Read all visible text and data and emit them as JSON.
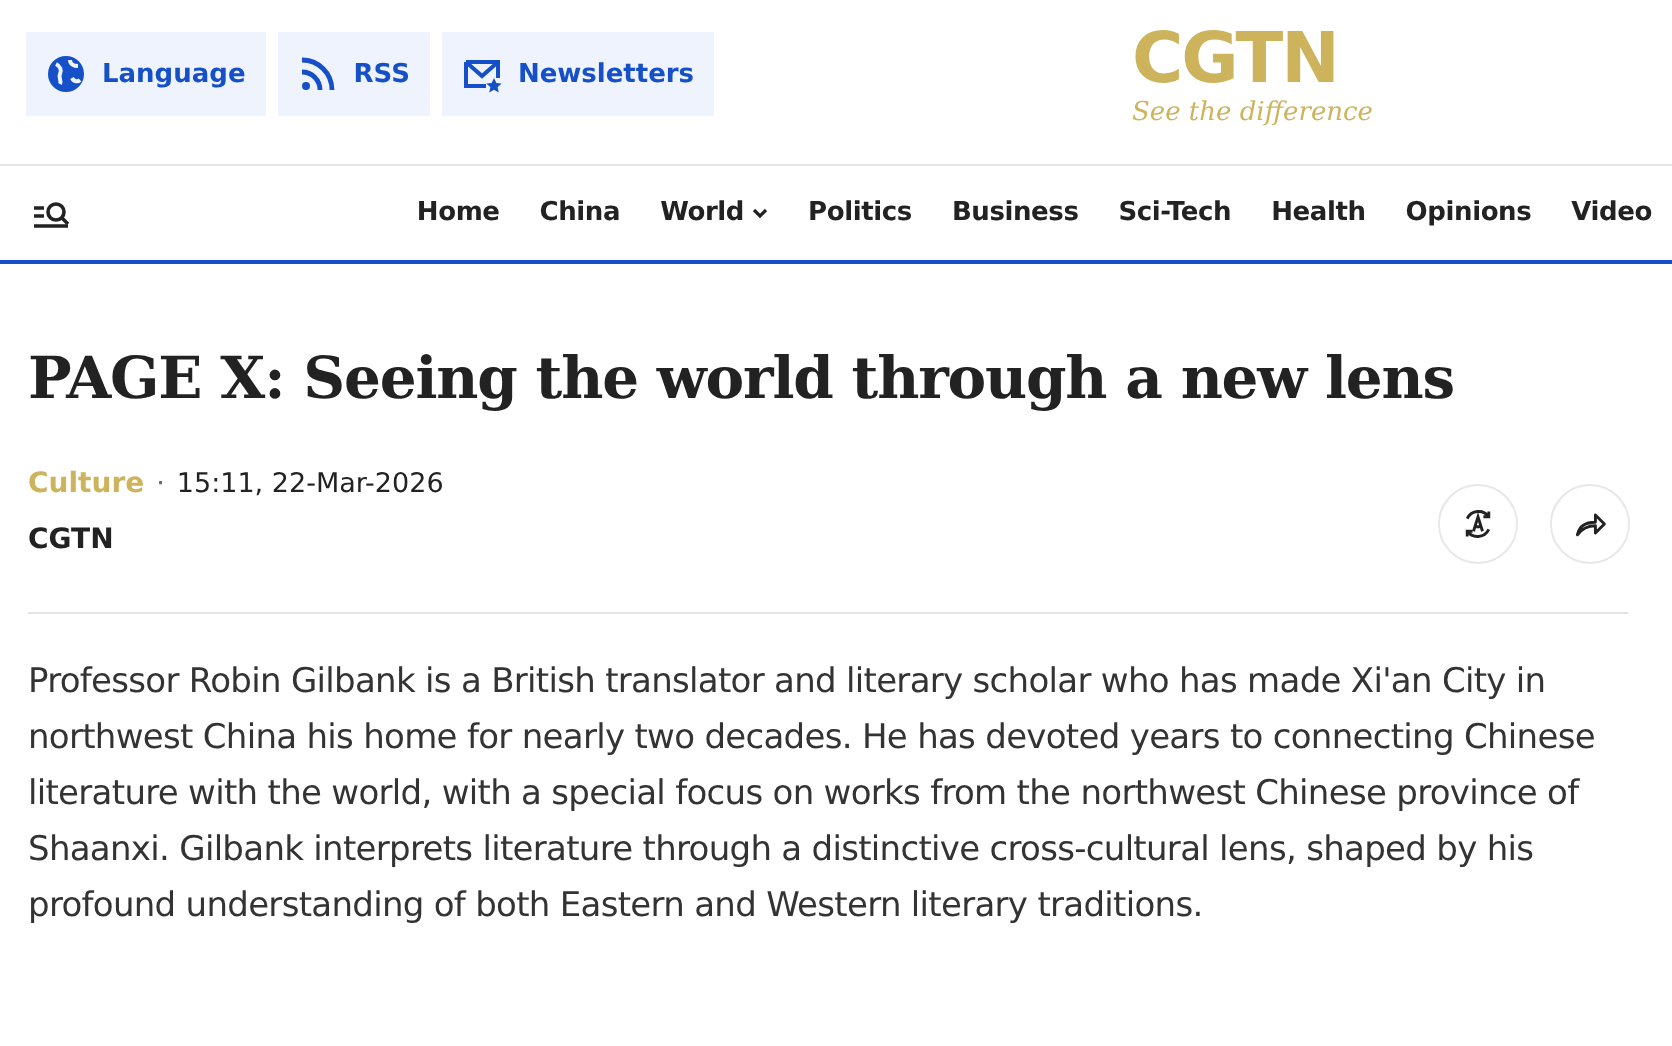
{
  "top_links": [
    {
      "kind": "globe",
      "label": "Language"
    },
    {
      "kind": "rss",
      "label": "RSS"
    },
    {
      "kind": "mail",
      "label": "Newsletters"
    }
  ],
  "logo": {
    "name": "CGTN",
    "tagline": "See the difference"
  },
  "nav": [
    {
      "label": "Home",
      "dropdown": false
    },
    {
      "label": "China",
      "dropdown": false
    },
    {
      "label": "World",
      "dropdown": true
    },
    {
      "label": "Politics",
      "dropdown": false
    },
    {
      "label": "Business",
      "dropdown": false
    },
    {
      "label": "Sci-Tech",
      "dropdown": false
    },
    {
      "label": "Health",
      "dropdown": false
    },
    {
      "label": "Opinions",
      "dropdown": false
    },
    {
      "label": "Video",
      "dropdown": false
    }
  ],
  "article": {
    "title": "PAGE X: Seeing the world through a new lens",
    "category": "Culture",
    "separator": "·",
    "timestamp": "15:11, 22-Mar-2026",
    "source": "CGTN",
    "actions": [
      {
        "kind": "translate"
      },
      {
        "kind": "share"
      }
    ],
    "body": "Professor Robin Gilbank is a British translator and literary scholar who has made Xi'an City in northwest China his home for nearly two decades. He has devoted years to connecting Chinese literature with the world, with a special focus on works from the northwest Chinese province of Shaanxi. Gilbank interprets literature through a distinctive cross-cultural lens, shaped by his profound understanding of both Eastern and Western literary traditions."
  }
}
